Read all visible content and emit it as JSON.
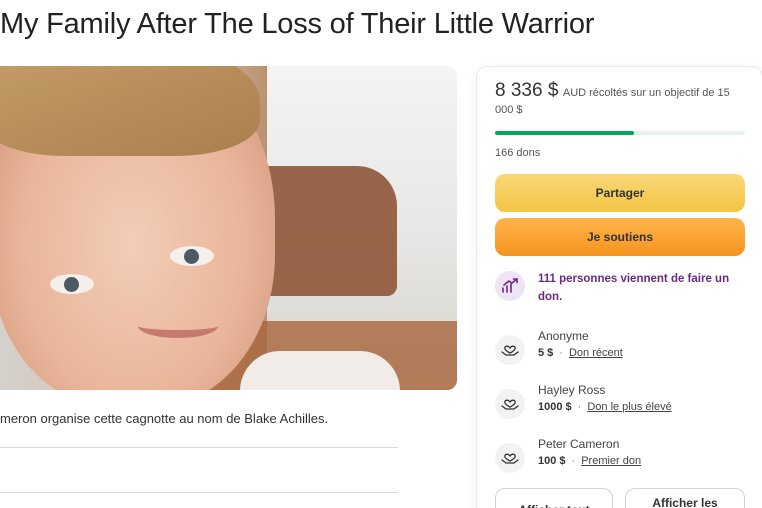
{
  "page": {
    "title": "My Family After The Loss of Their Little Warrior",
    "organiser_text": "meron organise cette cagnotte au nom de Blake Achilles."
  },
  "donation_panel": {
    "amount_raised": "8 336 $",
    "goal_text": "AUD récoltés sur un objectif de 15 000 $",
    "progress_fraction": 0.556,
    "donors_count": "166 dons",
    "share_label": "Partager",
    "support_label": "Je soutiens",
    "trend_text": "111 personnes viennent de faire un don.",
    "colors": {
      "progress": "#02a95c",
      "share": "#f3c544",
      "support": "#f6921e",
      "trend_text": "#6b2a82"
    }
  },
  "donations": [
    {
      "name": "Anonyme",
      "amount": "5 $",
      "tag": "Don récent",
      "icon": "hands-heart-icon"
    },
    {
      "name": "Hayley Ross",
      "amount": "1000 $",
      "tag": "Don le plus élevé",
      "icon": "hands-heart-icon"
    },
    {
      "name": "Peter Cameron",
      "amount": "100 $",
      "tag": "Premier don",
      "icon": "hands-heart-icon"
    }
  ],
  "bottom_buttons": {
    "left_label": "Afficher tout",
    "right_label": "Afficher les meilleurs"
  },
  "photo": {
    "alt": "Photo of smiling child"
  }
}
